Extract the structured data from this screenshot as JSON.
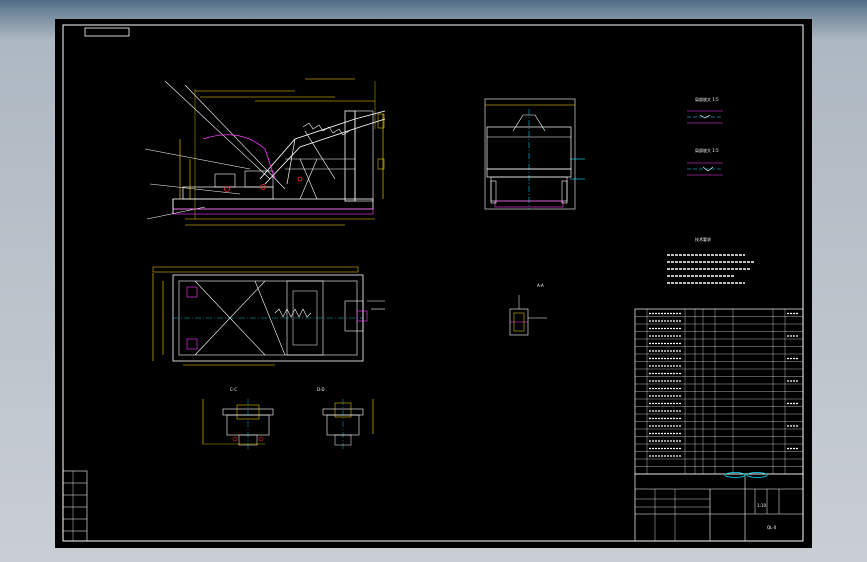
{
  "drawing": {
    "section_labels": [
      "C-C",
      "D-D",
      "A-A"
    ],
    "tech_notes_title": "技术要求",
    "view_label_1": "局部放大 1:5",
    "view_label_2": "局部放大 1:5",
    "title_block_drawing_no": "QL-0",
    "title_block_scale": "1:10"
  },
  "colors": {
    "background": "#000000",
    "frame": "#ffffff",
    "dimension": "#ffe000",
    "centerline": "#00e5ff",
    "accent": "#ff3cff"
  }
}
